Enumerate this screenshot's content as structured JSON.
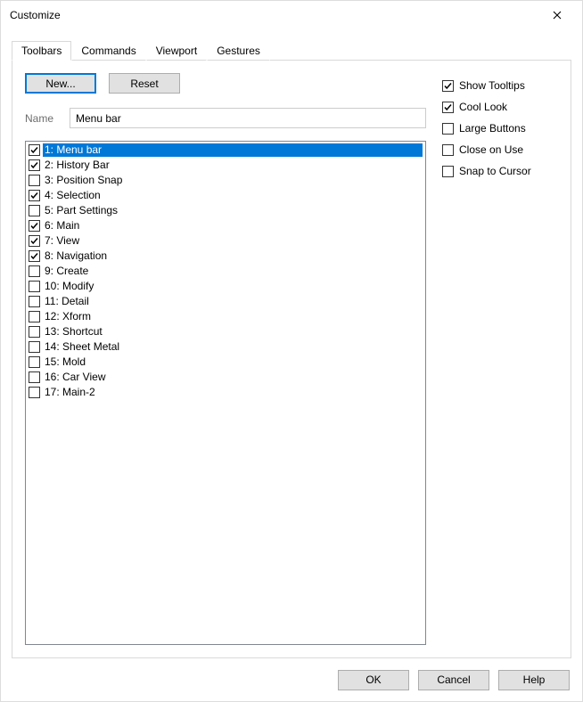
{
  "window": {
    "title": "Customize"
  },
  "tabs": [
    {
      "label": "Toolbars",
      "active": true
    },
    {
      "label": "Commands",
      "active": false
    },
    {
      "label": "Viewport",
      "active": false
    },
    {
      "label": "Gestures",
      "active": false
    }
  ],
  "buttons": {
    "new": "New...",
    "reset": "Reset"
  },
  "name_field": {
    "label": "Name",
    "value": "Menu bar"
  },
  "toolbars": [
    {
      "label": "1: Menu bar",
      "checked": true,
      "selected": true
    },
    {
      "label": "2: History Bar",
      "checked": true,
      "selected": false
    },
    {
      "label": "3: Position Snap",
      "checked": false,
      "selected": false
    },
    {
      "label": "4: Selection",
      "checked": true,
      "selected": false
    },
    {
      "label": "5: Part Settings",
      "checked": false,
      "selected": false
    },
    {
      "label": "6: Main",
      "checked": true,
      "selected": false
    },
    {
      "label": "7: View",
      "checked": true,
      "selected": false
    },
    {
      "label": "8: Navigation",
      "checked": true,
      "selected": false
    },
    {
      "label": "9: Create",
      "checked": false,
      "selected": false
    },
    {
      "label": "10: Modify",
      "checked": false,
      "selected": false
    },
    {
      "label": "11: Detail",
      "checked": false,
      "selected": false
    },
    {
      "label": "12: Xform",
      "checked": false,
      "selected": false
    },
    {
      "label": "13: Shortcut",
      "checked": false,
      "selected": false
    },
    {
      "label": "14: Sheet Metal",
      "checked": false,
      "selected": false
    },
    {
      "label": "15: Mold",
      "checked": false,
      "selected": false
    },
    {
      "label": "16: Car View",
      "checked": false,
      "selected": false
    },
    {
      "label": "17: Main-2",
      "checked": false,
      "selected": false
    }
  ],
  "options": [
    {
      "label": "Show Tooltips",
      "checked": true
    },
    {
      "label": "Cool Look",
      "checked": true
    },
    {
      "label": "Large Buttons",
      "checked": false
    },
    {
      "label": "Close on Use",
      "checked": false
    },
    {
      "label": "Snap to Cursor",
      "checked": false
    }
  ],
  "footer": {
    "ok": "OK",
    "cancel": "Cancel",
    "help": "Help"
  }
}
